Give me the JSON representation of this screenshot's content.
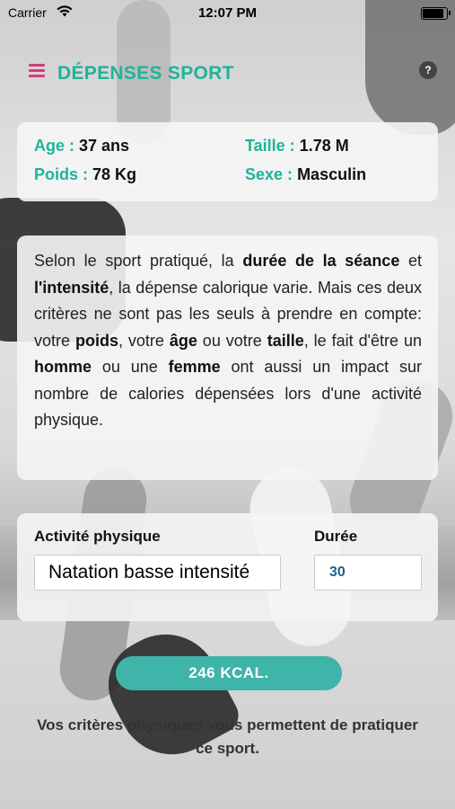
{
  "status_bar": {
    "carrier": "Carrier",
    "time": "12:07 PM"
  },
  "header": {
    "title": "DÉPENSES SPORT",
    "menu_icon": "hamburger-menu-icon",
    "help_icon": "help-icon"
  },
  "profile": {
    "age_label": "Age :",
    "age_value": "37 ans",
    "height_label": "Taille :",
    "height_value": "1.78 M",
    "weight_label": "Poids :",
    "weight_value": "78 Kg",
    "sex_label": "Sexe :",
    "sex_value": "Masculin"
  },
  "info": {
    "t1": "Selon le sport pratiqué, la ",
    "b1": "durée de la séance",
    "t2": " et ",
    "b2": "l'intensité",
    "t3": ", la dépense calorique varie. Mais ces deux critères ne sont pas les seuls à prendre en compte: votre ",
    "b3": "poids",
    "t4": ", votre ",
    "b4": "âge",
    "t5": " ou votre ",
    "b5": "taille",
    "t6": ", le fait d'être un ",
    "b6": "homme",
    "t7": " ou une ",
    "b7": "femme",
    "t8": " ont aussi un impact sur nombre de calories dépensées lors d'une activité physique."
  },
  "calculator": {
    "activity_label": "Activité physique",
    "activity_value": "Natation basse intensité",
    "duration_label": "Durée",
    "duration_value": "30"
  },
  "result": {
    "label": "246 KCAL."
  },
  "note": {
    "text": "Vos critères physiques vous permettent de pratiquer ce sport."
  },
  "colors": {
    "accent": "#1fb39a",
    "menu": "#d8397e",
    "button": "#3fb4a8"
  }
}
